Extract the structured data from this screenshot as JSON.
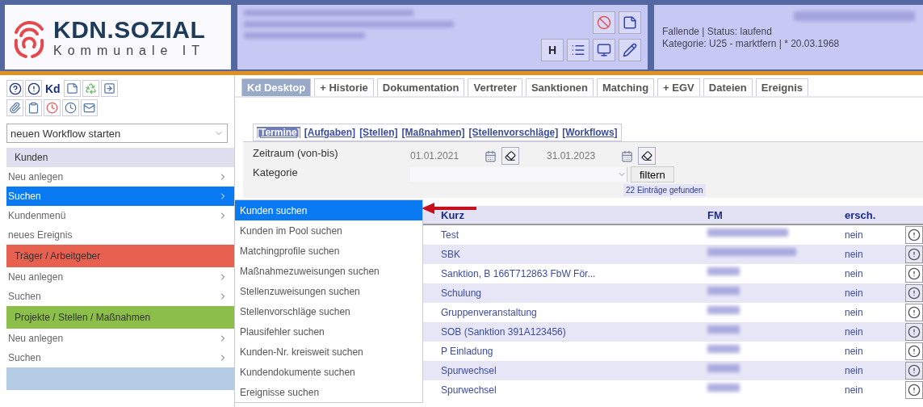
{
  "header": {
    "logo_title": "KDN.SOZIAL",
    "logo_subtitle": "Kommunale IT",
    "letter_button": "H",
    "info_lines": [
      "Fallende | Status: laufend",
      "Kategorie: U25 - marktfern | * 20.03.1968"
    ]
  },
  "sidebar": {
    "kd_label": "Kd",
    "workflow_select": {
      "value": "neuen Workflow starten"
    },
    "sections": [
      {
        "title": "Kunden",
        "color": "#dfdff0",
        "items": [
          {
            "label": "Neu anlegen",
            "submenu": true,
            "selected": false
          },
          {
            "label": "Suchen",
            "submenu": true,
            "selected": true
          },
          {
            "label": "Kundenmenü",
            "submenu": true,
            "selected": false
          },
          {
            "label": "neues Ereignis",
            "submenu": false,
            "selected": false
          }
        ]
      },
      {
        "title": "Träger / Arbeitgeber",
        "color": "#e8604f",
        "items": [
          {
            "label": "Neu anlegen",
            "submenu": true,
            "selected": false
          },
          {
            "label": "Suchen",
            "submenu": true,
            "selected": false
          }
        ]
      },
      {
        "title": "Projekte / Stellen / Maßnahmen",
        "color": "#8cbf4a",
        "items": [
          {
            "label": "Neu anlegen",
            "submenu": true,
            "selected": false
          },
          {
            "label": "Suchen",
            "submenu": true,
            "selected": false
          }
        ]
      },
      {
        "color": "#b4cbe6"
      }
    ]
  },
  "flyout": [
    {
      "label": "Kunden suchen",
      "selected": true
    },
    {
      "label": "Kunden im Pool suchen",
      "selected": false
    },
    {
      "label": "Matchingprofile suchen",
      "selected": false
    },
    {
      "label": "Maßnahmezuweisungen suchen",
      "selected": false
    },
    {
      "label": "Stellenzuweisungen suchen",
      "selected": false
    },
    {
      "label": "Stellenvorschläge suchen",
      "selected": false
    },
    {
      "label": "Plausifehler suchen",
      "selected": false
    },
    {
      "label": "Kunden-Nr. kreisweit suchen",
      "selected": false
    },
    {
      "label": "Kundendokumente suchen",
      "selected": false
    },
    {
      "label": "Ereignisse suchen",
      "selected": false
    }
  ],
  "tabs": [
    {
      "label": "Kd Desktop",
      "selected": true
    },
    {
      "label": "+ Historie",
      "selected": false
    },
    {
      "label": "Dokumentation",
      "selected": false
    },
    {
      "label": "Vertreter",
      "selected": false
    },
    {
      "label": "Sanktionen",
      "selected": false
    },
    {
      "label": "Matching",
      "selected": false
    },
    {
      "label": "+ EGV",
      "selected": false
    },
    {
      "label": "Dateien",
      "selected": false
    },
    {
      "label": "Ereignis",
      "selected": false
    }
  ],
  "sub_tabs": [
    {
      "label": "[Termine]",
      "selected": true
    },
    {
      "label": "[Aufgaben]",
      "selected": false
    },
    {
      "label": "[Stellen]",
      "selected": false
    },
    {
      "label": "[Maßnahmen]",
      "selected": false
    },
    {
      "label": "[Stellenvorschläge]",
      "selected": false
    },
    {
      "label": "[Workflows]",
      "selected": false
    }
  ],
  "filter": {
    "period_label": "Zeitraum (von-bis)",
    "date_from": "01.01.2021",
    "date_to": "31.01.2023",
    "category_label": "Kategorie",
    "filter_button": "filtern",
    "result_count": "22 Einträge gefunden"
  },
  "table": {
    "columns": [
      "Kurz",
      "FM",
      "ersch."
    ],
    "rows": [
      {
        "kurz": "Test",
        "ersch": "nein"
      },
      {
        "kurz": "SBK",
        "ersch": "nein"
      },
      {
        "kurz": "Sanktion, B 166T712863 FbW För...",
        "ersch": "nein"
      },
      {
        "kurz": "Schulung",
        "ersch": "nein"
      },
      {
        "kurz": "Gruppenveranstaltung",
        "ersch": "nein"
      },
      {
        "kurz": "SOB (Sanktion 391A123456)",
        "ersch": "nein"
      },
      {
        "kurz": "P Einladung",
        "ersch": "nein"
      },
      {
        "kurz": "Spurwechsel",
        "ersch": "nein"
      },
      {
        "kurz": "Spurwechsel",
        "ersch": "nein"
      }
    ]
  }
}
